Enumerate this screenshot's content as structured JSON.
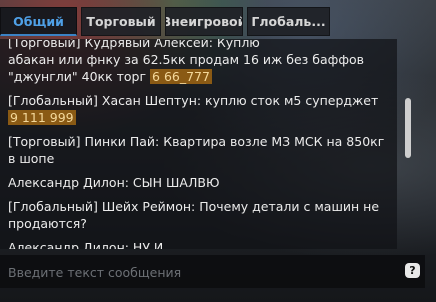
{
  "tabs": [
    {
      "label": "Общий",
      "active": true
    },
    {
      "label": "Торговый",
      "active": false
    },
    {
      "label": "Внеигровой",
      "active": false
    },
    {
      "label": "Глобаль...",
      "active": false
    }
  ],
  "messages": [
    {
      "text": "[Торговый] Кудрявый Алексей: Куплю",
      "highlight": ""
    },
    {
      "text": "абакан или фнку за 62.5кк продам 16 иж без баффов \"джунгли\" 40кк торг ",
      "highlight": "6 66_777"
    },
    {
      "text": "[Глобальный] Хасан Шептун: куплю сток м5 суперджет ",
      "highlight": "9 111 999"
    },
    {
      "text": "[Торговый] Пинки Пай: Квартира возле МЗ МСК на 850кг в шопе",
      "highlight": ""
    },
    {
      "text": "Александр Дилон: СЫН ШАЛВЮ",
      "highlight": ""
    },
    {
      "text": "[Глобальный] Шейх Реймон: Почему детали с машин не продаются?",
      "highlight": ""
    },
    {
      "text": "Александр Дилон: НУ И",
      "highlight": ""
    }
  ],
  "input": {
    "placeholder": "Введите текст сообщения",
    "value": ""
  },
  "help": {
    "label": "?"
  },
  "colors": {
    "accent": "#4fa0e6",
    "highlight_bg": "#8a5a14"
  }
}
